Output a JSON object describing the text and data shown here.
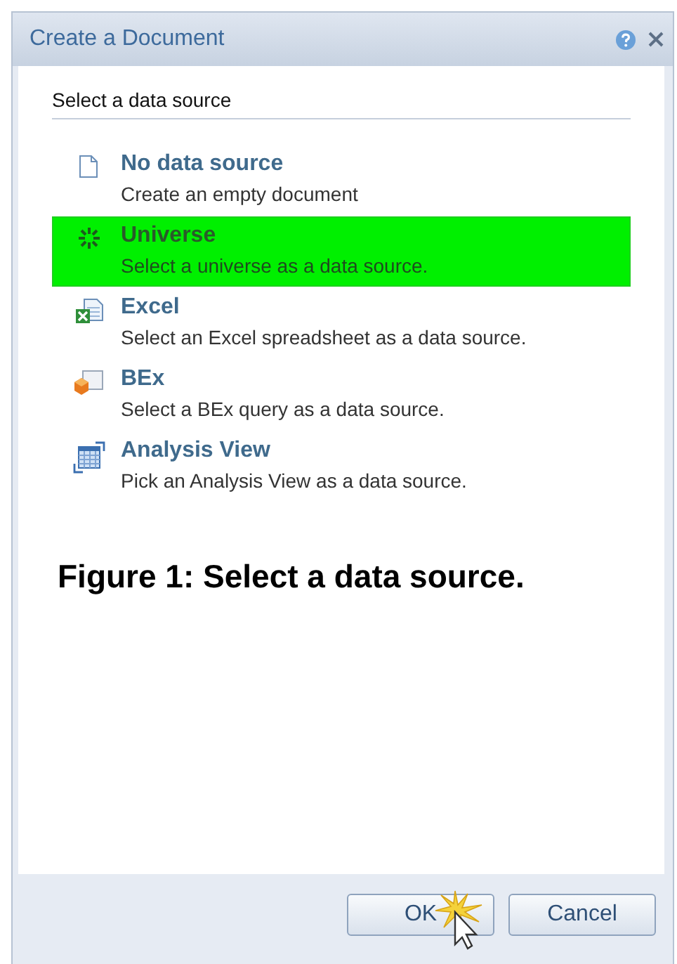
{
  "window": {
    "title": "Create a Document"
  },
  "section_heading": "Select a data source",
  "sources": [
    {
      "kind": "document",
      "name": "No data source",
      "description": "Create an empty document",
      "selected": false
    },
    {
      "kind": "universe",
      "name": "Universe",
      "description": "Select a universe as a data source.",
      "selected": true
    },
    {
      "kind": "excel",
      "name": "Excel",
      "description": "Select an Excel spreadsheet as a data source.",
      "selected": false
    },
    {
      "kind": "bex",
      "name": "BEx",
      "description": "Select a BEx query as a data source.",
      "selected": false
    },
    {
      "kind": "analysis",
      "name": "Analysis View",
      "description": "Pick an Analysis View as a data source.",
      "selected": false
    }
  ],
  "caption": "Figure 1: Select a data source.",
  "buttons": [
    "OK",
    "Cancel"
  ]
}
